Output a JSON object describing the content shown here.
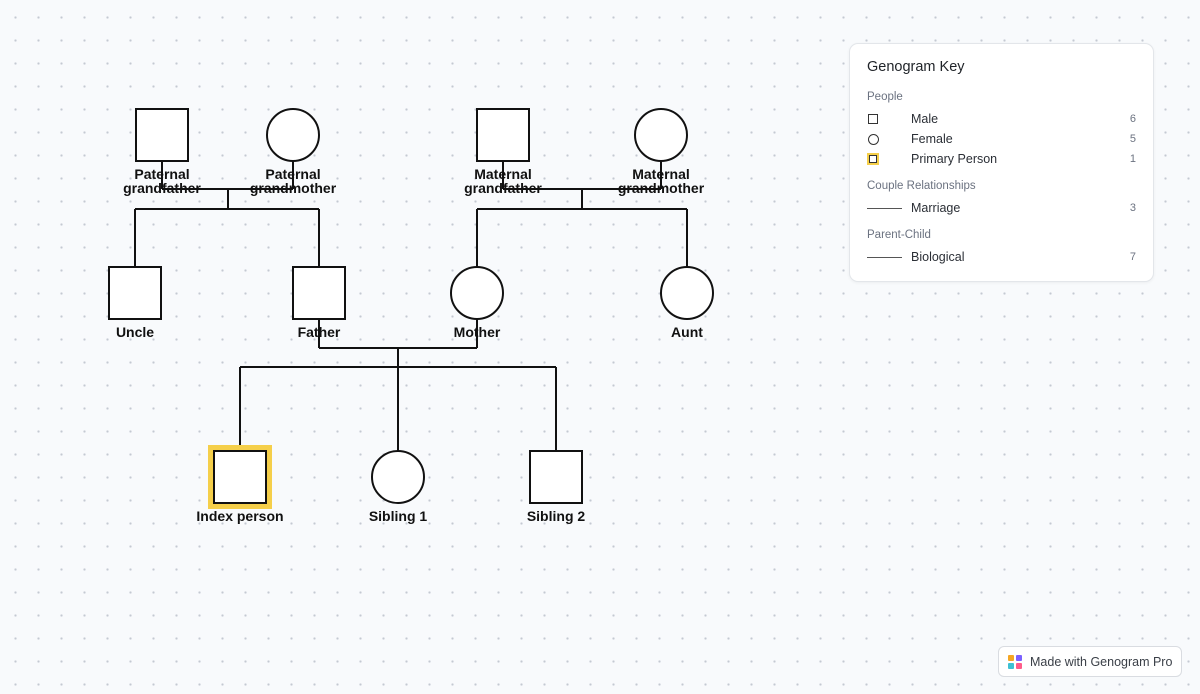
{
  "diagram": {
    "nodes": {
      "paternal_grandfather": {
        "label_line1": "Paternal",
        "label_line2": "grandfather",
        "sex": "male"
      },
      "paternal_grandmother": {
        "label_line1": "Paternal",
        "label_line2": "grandmother",
        "sex": "female"
      },
      "maternal_grandfather": {
        "label_line1": "Maternal",
        "label_line2": "grandfather",
        "sex": "male"
      },
      "maternal_grandmother": {
        "label_line1": "Maternal",
        "label_line2": "grandmother",
        "sex": "female"
      },
      "uncle": {
        "label": "Uncle",
        "sex": "male"
      },
      "father": {
        "label": "Father",
        "sex": "male"
      },
      "mother": {
        "label": "Mother",
        "sex": "female"
      },
      "aunt": {
        "label": "Aunt",
        "sex": "female"
      },
      "index_person": {
        "label": "Index person",
        "sex": "male",
        "primary": true
      },
      "sibling_1": {
        "label": "Sibling 1",
        "sex": "female"
      },
      "sibling_2": {
        "label": "Sibling 2",
        "sex": "male"
      }
    },
    "marriages": [
      [
        "paternal_grandfather",
        "paternal_grandmother"
      ],
      [
        "maternal_grandfather",
        "maternal_grandmother"
      ],
      [
        "father",
        "mother"
      ]
    ],
    "parent_child": [
      {
        "couple": 0,
        "children": [
          "uncle",
          "father"
        ]
      },
      {
        "couple": 1,
        "children": [
          "mother",
          "aunt"
        ]
      },
      {
        "couple": 2,
        "children": [
          "index_person",
          "sibling_1",
          "sibling_2"
        ]
      }
    ],
    "colors": {
      "line": "#111111",
      "primary_highlight": "#f5cf4a"
    }
  },
  "legend": {
    "title": "Genogram Key",
    "people_heading": "People",
    "male_label": "Male",
    "male_count": "6",
    "female_label": "Female",
    "female_count": "5",
    "primary_label": "Primary Person",
    "primary_count": "1",
    "couple_heading": "Couple Relationships",
    "marriage_label": "Marriage",
    "marriage_count": "3",
    "parent_child_heading": "Parent-Child",
    "biological_label": "Biological",
    "biological_count": "7"
  },
  "badge": {
    "text": "Made with Genogram Pro",
    "logo_colors": [
      "#f5a623",
      "#7b61ff",
      "#3ec1d3",
      "#ff5c8a"
    ]
  }
}
